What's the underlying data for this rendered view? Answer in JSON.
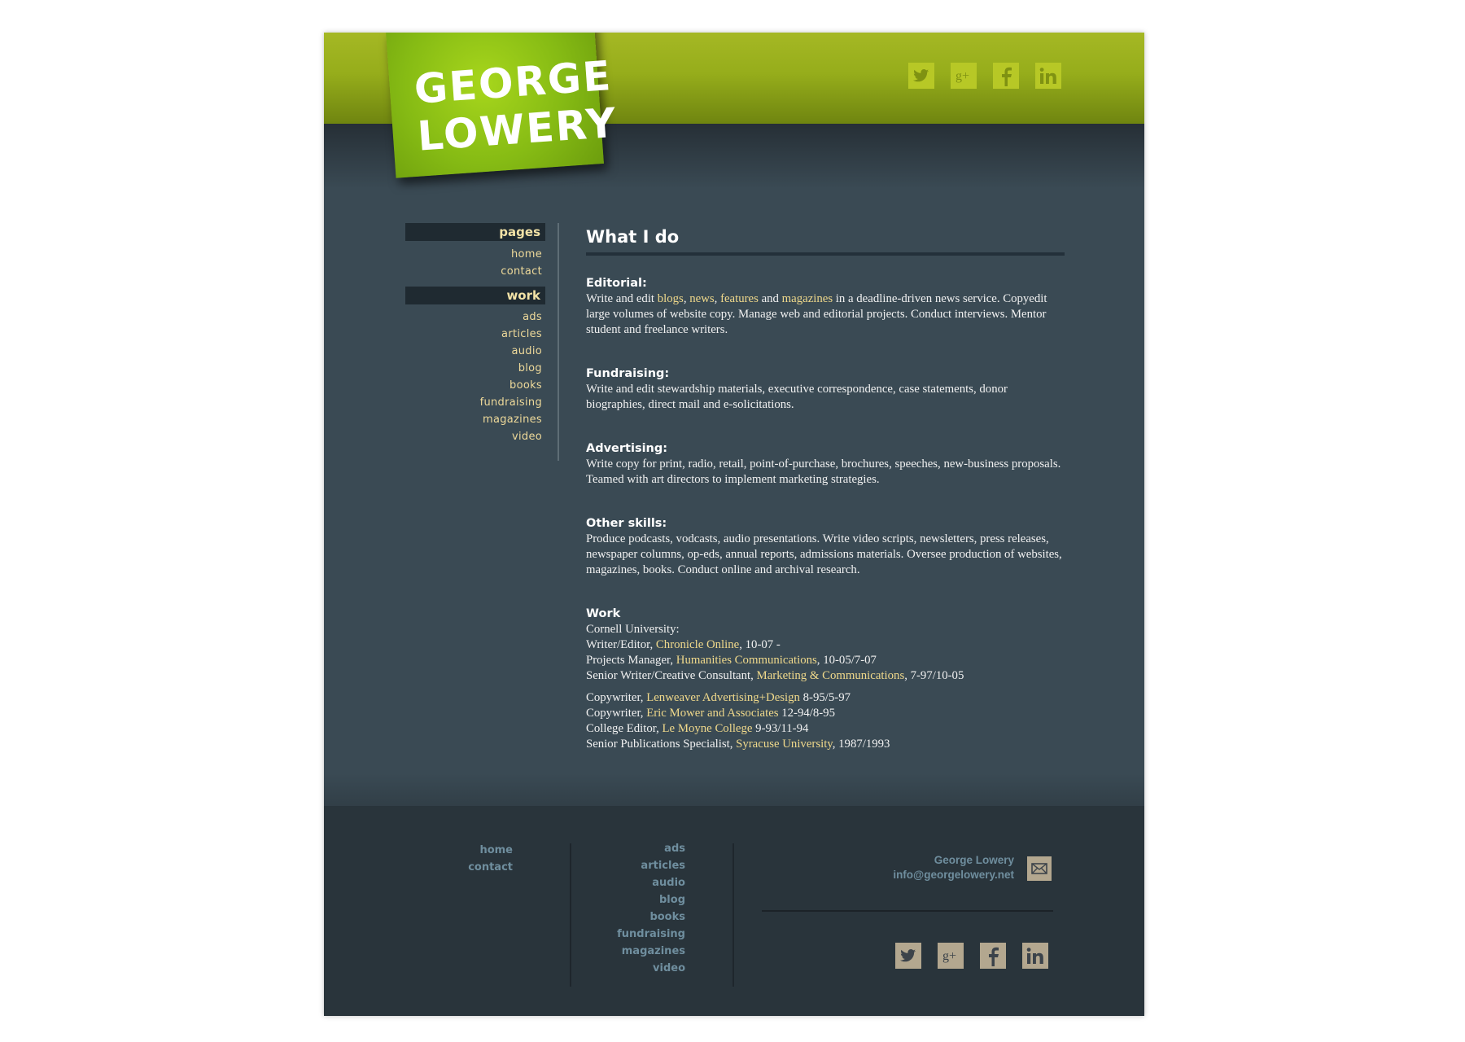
{
  "logo": {
    "line1": "GEORGE",
    "line2": "LOWERY"
  },
  "social_icons": [
    "twitter-icon",
    "google-plus-icon",
    "facebook-icon",
    "linkedin-icon"
  ],
  "colors": {
    "header_green": "#96ad1b",
    "body_bg": "#3a4a54",
    "footer_bg": "#29343b",
    "link": "#f0d98b",
    "nav_text": "#eed99a",
    "footer_text": "#6f8e9e"
  },
  "nav": {
    "pages_heading": "pages",
    "pages": [
      "home",
      "contact"
    ],
    "work_heading": "work",
    "work": [
      "ads",
      "articles",
      "audio",
      "blog",
      "books",
      "fundraising",
      "magazines",
      "video"
    ]
  },
  "main": {
    "title": "What I do",
    "editorial": {
      "heading": "Editorial:",
      "t1": "Write and edit ",
      "l1": "blogs",
      "t2": ", ",
      "l2": "news",
      "t3": ", ",
      "l3": "features",
      "t4": " and ",
      "l4": "magazines",
      "t5": " in a deadline-driven news service. Copyedit large volumes of website copy. Manage web and editorial projects. Conduct interviews. Mentor student and freelance writers."
    },
    "fundraising": {
      "heading": "Fundraising:",
      "body": "Write and edit stewardship materials, executive correspondence, case statements, donor biographies, direct mail and e-solicitations."
    },
    "advertising": {
      "heading": "Advertising:",
      "body": "Write copy for print, radio, retail, point-of-purchase, brochures, speeches, new-business proposals. Teamed with art directors to implement marketing strategies."
    },
    "other": {
      "heading": "Other skills:",
      "body": "Produce podcasts, vodcasts, audio presentations. Write video scripts, newsletters, press releases, newspaper columns, op-eds, annual reports, admissions materials. Oversee production of websites, magazines, books. Conduct online and archival research."
    },
    "work": {
      "heading": "Work",
      "intro": "Cornell University:",
      "jobs": [
        {
          "role": "Writer/Editor, ",
          "org": "Chronicle Online",
          "dates": ", 10-07 -"
        },
        {
          "role": "Projects Manager, ",
          "org": "Humanities Communications",
          "dates": ", 10-05/7-07"
        },
        {
          "role": "Senior Writer/Creative Consultant, ",
          "org": "Marketing & Communications",
          "dates": ", 7-97/10-05"
        }
      ],
      "jobs2": [
        {
          "role": "Copywriter, ",
          "org": "Lenweaver Advertising+Design",
          "dates": " 8-95/5-97"
        },
        {
          "role": "Copywriter, ",
          "org": "Eric Mower and Associates",
          "dates": " 12-94/8-95"
        },
        {
          "role": "College Editor, ",
          "org": "Le Moyne College",
          "dates": " 9-93/11-94"
        },
        {
          "role": "Senior Publications Specialist, ",
          "org": "Syracuse University",
          "dates": ", 1987/1993"
        }
      ]
    }
  },
  "footer": {
    "pages": [
      "home",
      "contact"
    ],
    "work": [
      "ads",
      "articles",
      "audio",
      "blog",
      "books",
      "fundraising",
      "magazines",
      "video"
    ],
    "contact_name": "George Lowery",
    "contact_email": "info@georgelowery.net",
    "mail_icon": "mail-icon"
  }
}
